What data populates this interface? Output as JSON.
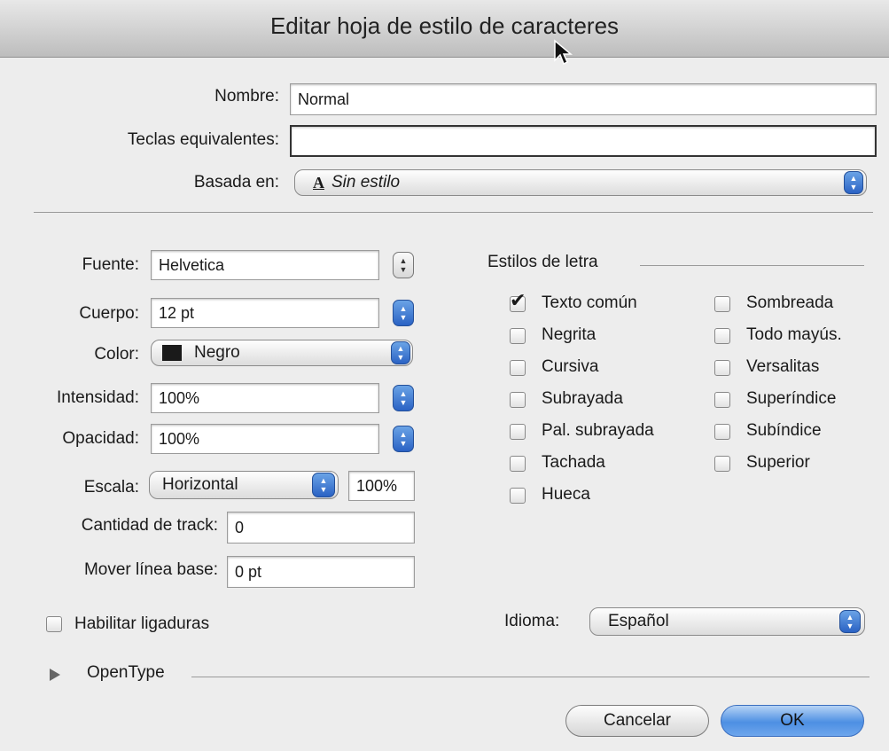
{
  "window": {
    "title": "Editar hoja de estilo de caracteres"
  },
  "top": {
    "nombre_label": "Nombre:",
    "nombre_value": "Normal",
    "teclas_label": "Teclas equivalentes:",
    "teclas_value": "",
    "basada_label": "Basada en:",
    "basada_value": "Sin estilo",
    "basada_icon": "A"
  },
  "font": {
    "fuente_label": "Fuente:",
    "fuente_value": "Helvetica",
    "cuerpo_label": "Cuerpo:",
    "cuerpo_value": "12 pt",
    "color_label": "Color:",
    "color_value": "Negro",
    "color_swatch": "#1a1a1a",
    "intensidad_label": "Intensidad:",
    "intensidad_value": "100%",
    "opacidad_label": "Opacidad:",
    "opacidad_value": "100%",
    "escala_label": "Escala:",
    "escala_value": "Horizontal",
    "escala_percent": "100%",
    "track_label": "Cantidad de track:",
    "track_value": "0",
    "baseline_label": "Mover línea base:",
    "baseline_value": "0 pt",
    "ligaduras_label": "Habilitar ligaduras"
  },
  "styles": {
    "heading": "Estilos de letra",
    "col1": [
      {
        "label": "Texto común",
        "checked": true
      },
      {
        "label": "Negrita",
        "checked": false
      },
      {
        "label": "Cursiva",
        "checked": false
      },
      {
        "label": "Subrayada",
        "checked": false
      },
      {
        "label": "Pal. subrayada",
        "checked": false
      },
      {
        "label": "Tachada",
        "checked": false
      },
      {
        "label": "Hueca",
        "checked": false
      }
    ],
    "col2": [
      {
        "label": "Sombreada",
        "checked": false
      },
      {
        "label": "Todo mayús.",
        "checked": false
      },
      {
        "label": "Versalitas",
        "checked": false
      },
      {
        "label": "Superíndice",
        "checked": false
      },
      {
        "label": "Subíndice",
        "checked": false
      },
      {
        "label": "Superior",
        "checked": false
      }
    ]
  },
  "idioma": {
    "label": "Idioma:",
    "value": "Español"
  },
  "opentype": {
    "label": "OpenType"
  },
  "buttons": {
    "cancel": "Cancelar",
    "ok": "OK"
  },
  "colors": {
    "accent": "#3b7fe0"
  }
}
